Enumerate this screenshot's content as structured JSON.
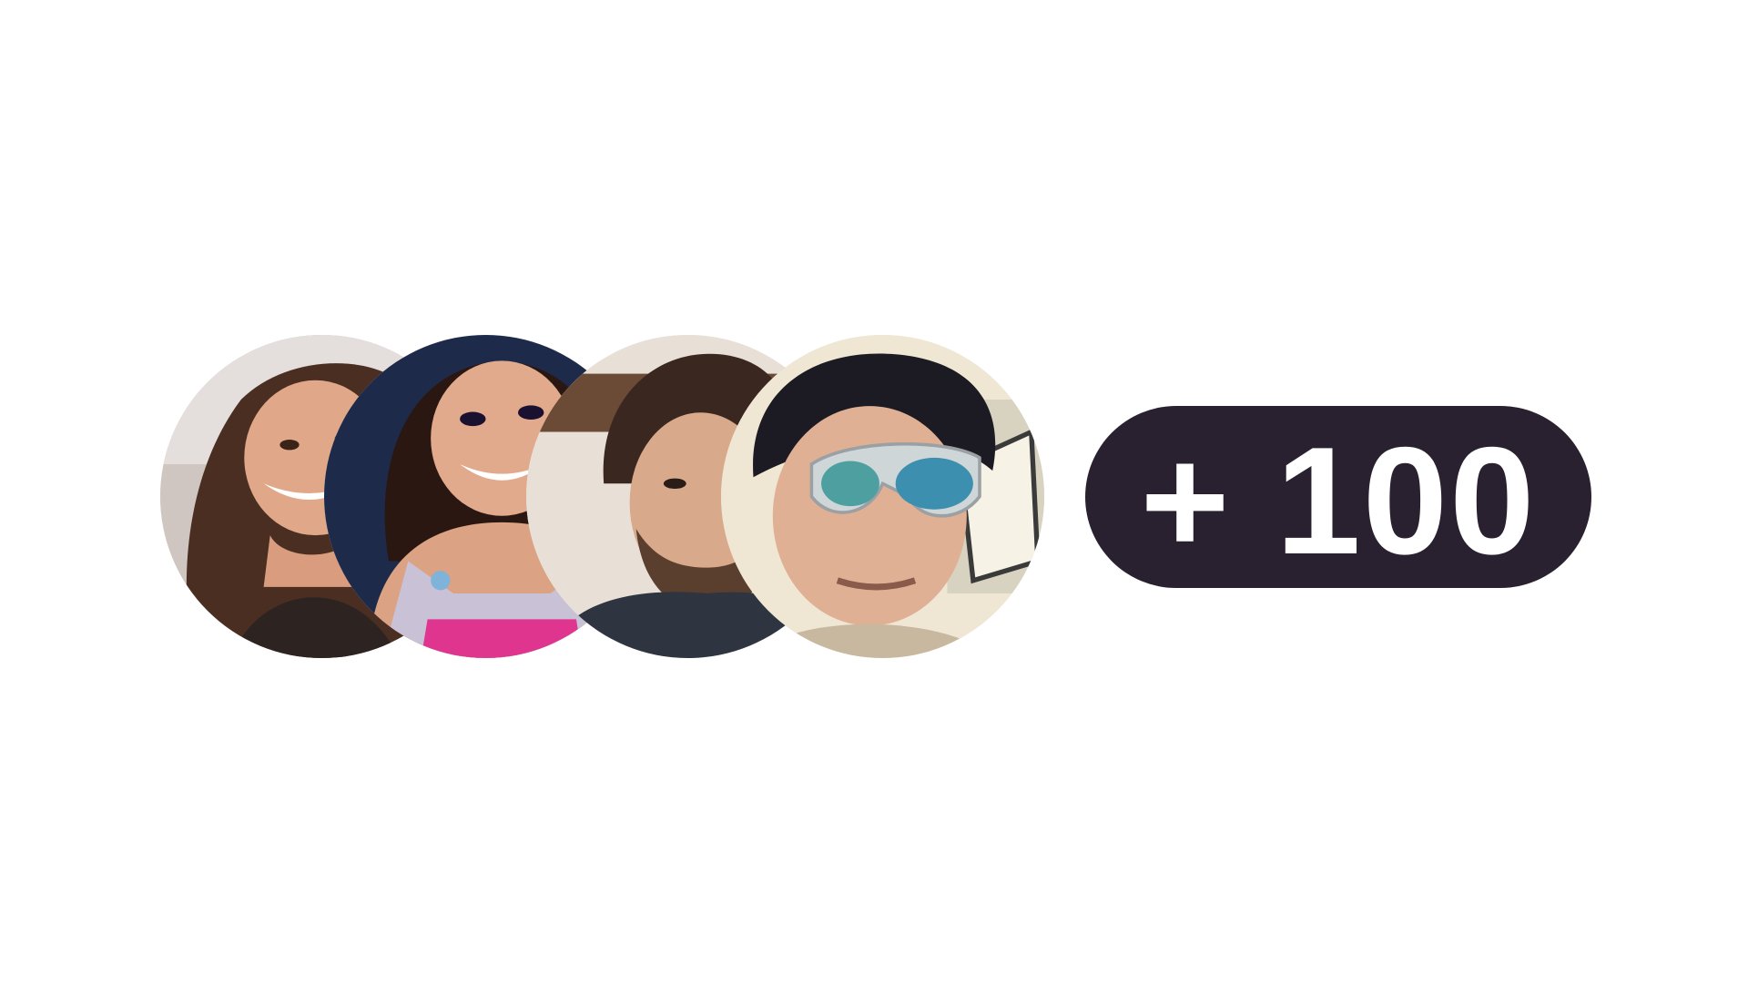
{
  "avatars": [
    {
      "name": "avatar-woman-brown-hair"
    },
    {
      "name": "avatar-woman-pink-top"
    },
    {
      "name": "avatar-man-beard"
    },
    {
      "name": "avatar-man-sunglasses"
    }
  ],
  "counter": {
    "label": "+ 100"
  },
  "colors": {
    "pill_background": "#2a2130",
    "pill_text": "#ffffff",
    "page_background": "#ffffff"
  }
}
